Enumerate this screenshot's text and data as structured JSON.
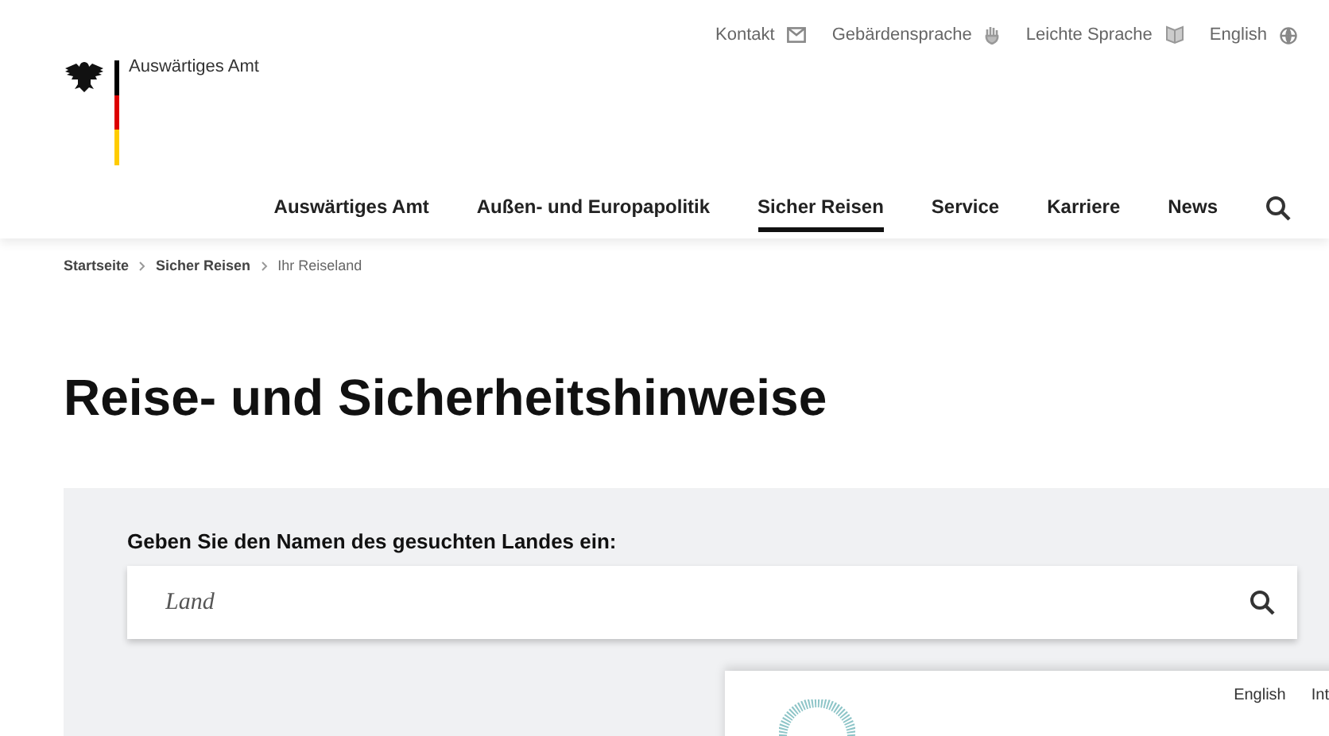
{
  "header": {
    "logo_text": "Auswärtiges Amt",
    "utility_links": [
      {
        "label": "Kontakt",
        "kind": "mail"
      },
      {
        "label": "Gebärdensprache",
        "kind": "hand"
      },
      {
        "label": "Leichte Sprache",
        "kind": "book"
      },
      {
        "label": "English",
        "kind": "globe"
      }
    ],
    "nav": [
      {
        "label": "Auswärtiges Amt",
        "selected": false
      },
      {
        "label": "Außen- und Europapolitik",
        "selected": false
      },
      {
        "label": "Sicher Reisen",
        "selected": true
      },
      {
        "label": "Service",
        "selected": false
      },
      {
        "label": "Karriere",
        "selected": false
      },
      {
        "label": "News",
        "selected": false
      }
    ]
  },
  "breadcrumb": [
    {
      "label": "Startseite",
      "current": false
    },
    {
      "label": "Sicher Reisen",
      "current": false
    },
    {
      "label": "Ihr Reiseland",
      "current": true
    }
  ],
  "heading": "Reise- und Sicherheitshinweise",
  "search": {
    "label": "Geben Sie den Namen des gesuchten Landes ein:",
    "placeholder": "Land"
  },
  "overlay": {
    "links": [
      "English",
      "Int"
    ]
  }
}
